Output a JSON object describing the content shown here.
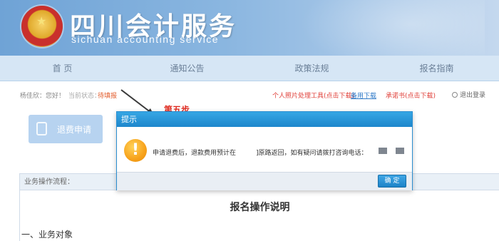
{
  "header": {
    "title": "四川会计服务",
    "subtitle": "sichuan accounting service"
  },
  "nav": {
    "items": [
      {
        "label": "首 页"
      },
      {
        "label": "通知公告"
      },
      {
        "label": "政策法规"
      },
      {
        "label": "报名指南"
      }
    ]
  },
  "status_bar": {
    "user": "杨佳欣：您好！",
    "state_label": "当前状态：",
    "state_value": "待填报",
    "photo_tool": "个人照片处理工具(点击下载)",
    "backup_download": "备用下载",
    "promise_letter": "承诺书(点击下载)",
    "logout": "退出登录"
  },
  "refund_button": {
    "label": "退费申请"
  },
  "annotation": {
    "step": "第五步"
  },
  "dialog": {
    "title": "提示",
    "message_part1": "申请退费后，退款费用预计在",
    "message_part2": "]原路返回，如有疑问请拨打咨询电话：",
    "ok_label": "确 定"
  },
  "process": {
    "header": "业务操作流程：",
    "title": "报名操作说明",
    "section_1": "一、业务对象"
  },
  "colors": {
    "accent_blue": "#1e87cc",
    "warning_red": "#e02b20",
    "nav_bg": "#d6e6f5"
  }
}
